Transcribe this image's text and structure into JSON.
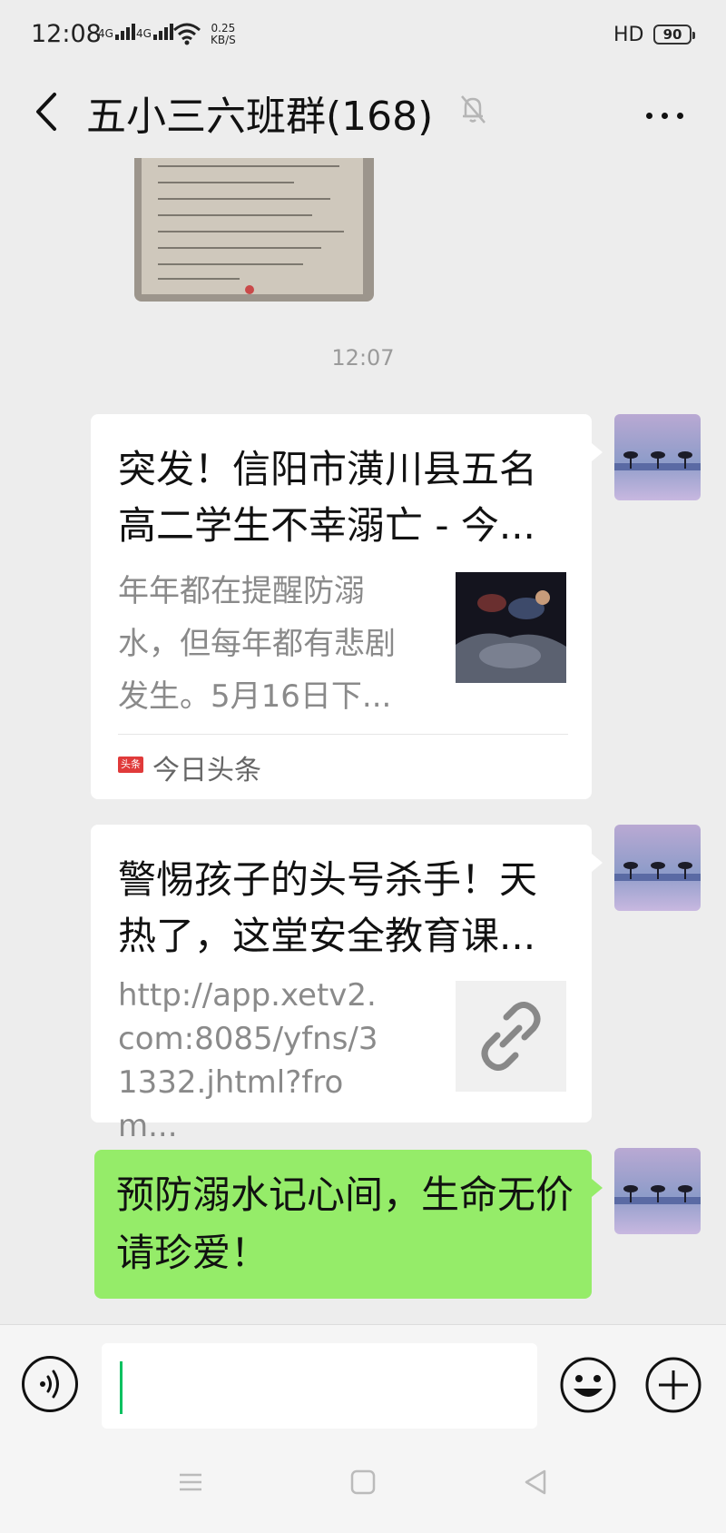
{
  "status_bar": {
    "time": "12:08",
    "signal1": "4G",
    "signal2": "4G",
    "speed_value": "0.25",
    "speed_unit": "KB/S",
    "hd": "HD",
    "battery": "90"
  },
  "nav": {
    "title": "五小三六班群(168)"
  },
  "chat": {
    "timestamp": "12:07",
    "messages": [
      {
        "type": "link-card",
        "title": "突发！信阳市潢川县五名高二学生不幸溺亡 - 今...",
        "description": "年年都在提醒防溺水，但每年都有悲剧发生。5月16日下...",
        "source": "今日头条",
        "source_logo": "头条"
      },
      {
        "type": "link-card",
        "title": "警惕孩子的头号杀手！天热了，这堂安全教育课...",
        "description": "http://app.xetv2.com:8085/yfns/31332.jhtml?from..."
      },
      {
        "type": "text",
        "text": "预防溺水记心间，生命无价请珍爱！"
      }
    ]
  },
  "colors": {
    "bubble_green": "#95ec69",
    "background": "#ededed",
    "caret": "#07c160"
  }
}
